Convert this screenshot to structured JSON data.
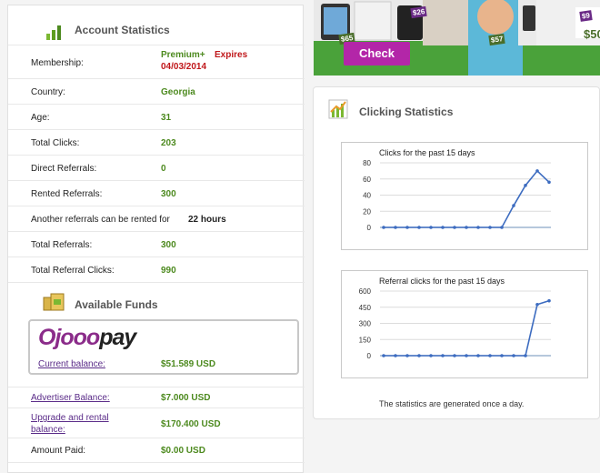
{
  "account": {
    "title": "Account Statistics",
    "rows": [
      {
        "label": "Membership:",
        "value": "Premium+",
        "value2": "Expires",
        "value3": "04/03/2014"
      },
      {
        "label": "Country:",
        "value": "Georgia"
      },
      {
        "label": "Age:",
        "value": "31"
      },
      {
        "label": "Total Clicks:",
        "value": "203"
      },
      {
        "label": "Direct Referrals:",
        "value": "0"
      },
      {
        "label": "Rented Referrals:",
        "value": "300"
      },
      {
        "label_a": "Another referrals can be rented for",
        "label_b": "22 hours"
      },
      {
        "label": "Total Referrals:",
        "value": "300"
      },
      {
        "label": "Total Referral Clicks:",
        "value": "990"
      }
    ]
  },
  "funds": {
    "title": "Available Funds",
    "logo_text_a": "Ojooo",
    "logo_text_b": "pay",
    "current_balance_label": "Current balance:",
    "current_balance_value": "$51.589 USD",
    "rows": [
      {
        "label": "Advertiser Balance:",
        "value": "$7.000 USD"
      },
      {
        "label_a": "Upgrade and rental",
        "label_b": "balance:",
        "value": "$170.400 USD"
      },
      {
        "label": "Amount Paid:",
        "value": "$0.00 USD"
      }
    ]
  },
  "banner": {
    "check_label": "Check",
    "price_tags": [
      "$65",
      "$26",
      "$57",
      "$9",
      "$50"
    ]
  },
  "clicking": {
    "title": "Clicking Statistics",
    "footnote": "The statistics are generated once a day."
  },
  "colors": {
    "green_value": "#4d8a1f",
    "red_value": "#c0181b",
    "link": "#5a2b88",
    "line": "#3d6cc0",
    "check_button": "#b326a8"
  },
  "chart_data": [
    {
      "type": "line",
      "title": "Clicks for the past 15 days",
      "x": [
        1,
        2,
        3,
        4,
        5,
        6,
        7,
        8,
        9,
        10,
        11,
        12,
        13,
        14,
        15
      ],
      "series": [
        {
          "values": [
            0,
            0,
            0,
            0,
            0,
            0,
            0,
            0,
            0,
            0,
            0,
            27,
            52,
            70,
            56
          ]
        }
      ],
      "yticks": [
        0,
        20,
        40,
        60,
        80
      ],
      "ylim": [
        0,
        80
      ],
      "grid": true
    },
    {
      "type": "line",
      "title": "Referral clicks for the past 15 days",
      "x": [
        1,
        2,
        3,
        4,
        5,
        6,
        7,
        8,
        9,
        10,
        11,
        12,
        13,
        14,
        15
      ],
      "series": [
        {
          "values": [
            0,
            0,
            0,
            0,
            0,
            0,
            0,
            0,
            0,
            0,
            0,
            0,
            0,
            475,
            510
          ]
        }
      ],
      "yticks": [
        0,
        150,
        300,
        450,
        600
      ],
      "ylim": [
        0,
        600
      ],
      "grid": true
    }
  ]
}
